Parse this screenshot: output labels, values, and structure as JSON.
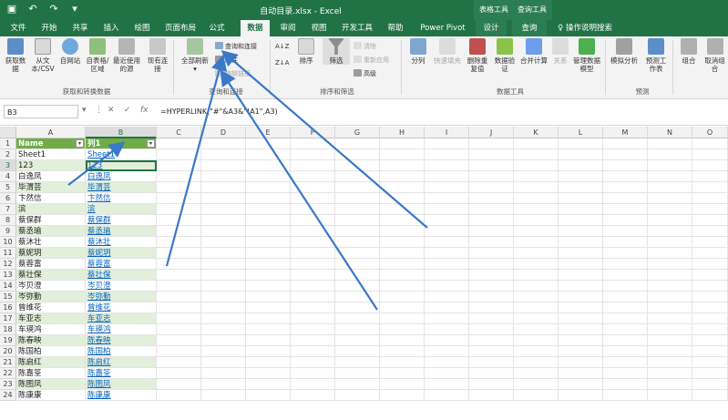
{
  "titlebar": {
    "doc_title": "自动目录.xlsx - Excel",
    "context_groups": [
      "表格工具",
      "查询工具"
    ]
  },
  "tabs": [
    {
      "label": "文件"
    },
    {
      "label": "开始"
    },
    {
      "label": "共享"
    },
    {
      "label": "插入"
    },
    {
      "label": "绘图"
    },
    {
      "label": "页面布局"
    },
    {
      "label": "公式"
    },
    {
      "label": "数据"
    },
    {
      "label": "审阅"
    },
    {
      "label": "视图"
    },
    {
      "label": "开发工具"
    },
    {
      "label": "帮助"
    },
    {
      "label": "Power Pivot"
    },
    {
      "label": "设计"
    },
    {
      "label": "查询"
    },
    {
      "label": "操作说明搜索"
    }
  ],
  "ribbon": {
    "get_data": {
      "btn1": "获取数据",
      "btn2": "从文本/CSV",
      "btn3": "自网站",
      "btn4": "自表格/区域",
      "btn5": "最近使用的源",
      "btn6": "现有连接",
      "group_label": "获取和转换数据"
    },
    "queries": {
      "refresh_all": "全部刷新",
      "queries_connections": "查询和连接",
      "properties": "属性",
      "edit_links": "编辑链接",
      "group_label": "查询和连接"
    },
    "sort_filter": {
      "sort": "排序",
      "filter": "筛选",
      "clear": "清除",
      "reapply": "重新应用",
      "advanced": "高级",
      "group_label": "排序和筛选"
    },
    "data_tools": {
      "split": "分列",
      "flash_fill": "快速填充",
      "remove_dup": "删除重复值",
      "validation": "数据验证",
      "consolidate": "合并计算",
      "relationships": "关系",
      "data_model": "管理数据模型",
      "group_label": "数据工具"
    },
    "forecast": {
      "what_if": "模拟分析",
      "forecast_sheet": "预测工作表",
      "group_label": "预测"
    },
    "outline": {
      "group": "组合",
      "ungroup": "取消组合"
    }
  },
  "formula_bar": {
    "name_box": "B3",
    "cancel": "✕",
    "confirm": "✓",
    "fx": "fx",
    "formula": "=HYPERLINK(\"#\"&A3&\"!A1\",A3)"
  },
  "columns": [
    "A",
    "B",
    "C",
    "D",
    "E",
    "F",
    "G",
    "H",
    "I",
    "J",
    "K",
    "L",
    "M",
    "N",
    "O"
  ],
  "row_numbers": [
    "1",
    "2",
    "3",
    "4",
    "5",
    "6",
    "7",
    "8",
    "9",
    "10",
    "11",
    "12",
    "13",
    "14",
    "15",
    "16",
    "17",
    "18",
    "19",
    "20",
    "21",
    "22",
    "23",
    "24"
  ],
  "table": {
    "headers": [
      "Name",
      "列1"
    ],
    "rows": [
      [
        "Sheet1",
        "Sheet1"
      ],
      [
        "123",
        "123"
      ],
      [
        "白逸凤",
        "白逸凤"
      ],
      [
        "毕渭芸",
        "毕渭芸"
      ],
      [
        "卞然信",
        "卞然信"
      ],
      [
        "滨",
        "滨"
      ],
      [
        "蔡保群",
        "蔡保群"
      ],
      [
        "蔡丞瑜",
        "蔡丞瑜"
      ],
      [
        "蔡沐壮",
        "蔡沐壮"
      ],
      [
        "蔡妮玥",
        "蔡妮玥"
      ],
      [
        "蔡蓉富",
        "蔡蓉富"
      ],
      [
        "蔡壮保",
        "蔡壮保"
      ],
      [
        "岑贝澄",
        "岑贝澄"
      ],
      [
        "岑弥勤",
        "岑弥勤"
      ],
      [
        "曾维花",
        "曾维花"
      ],
      [
        "车亚志",
        "车亚志"
      ],
      [
        "车瑛鸿",
        "车瑛鸿"
      ],
      [
        "陈春映",
        "陈春映"
      ],
      [
        "陈国柏",
        "陈国柏"
      ],
      [
        "陈启红",
        "陈启红"
      ],
      [
        "陈嘉筌",
        "陈嘉筌"
      ],
      [
        "陈图凤",
        "陈图凤"
      ],
      [
        "陈康康",
        "陈康康"
      ]
    ]
  },
  "colors": {
    "excel_green": "#217346",
    "table_header": "#70ad47",
    "table_band": "#e2efda",
    "link": "#0563c1",
    "arrow": "#3a78c8"
  }
}
